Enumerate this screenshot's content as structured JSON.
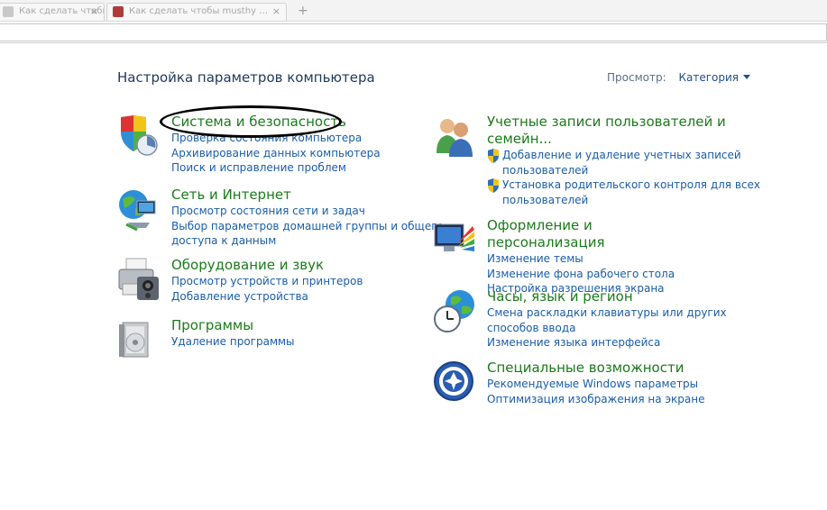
{
  "browser": {
    "tabs": [
      {
        "label": "Как сделать чтобы при вк…"
      },
      {
        "label": "Как сделать чтобы musthy …"
      }
    ],
    "new_tab_symbol": "+",
    "close_symbol": "×"
  },
  "header": {
    "title": "Настройка параметров компьютера",
    "view_label": "Просмотр:",
    "view_value": "Категория"
  },
  "left_column": [
    {
      "icon": "shield-security-icon",
      "title": "Система и безопасность",
      "links": [
        "Проверка состояния компьютера",
        "Архивирование данных компьютера",
        "Поиск и исправление проблем"
      ]
    },
    {
      "icon": "network-globe-icon",
      "title": "Сеть и Интернет",
      "links": [
        "Просмотр состояния сети и задач",
        "Выбор параметров домашней группы и общего",
        "доступа к данным"
      ]
    },
    {
      "icon": "printer-hardware-icon",
      "title": "Оборудование и звук",
      "links": [
        "Просмотр устройств и принтеров",
        "Добавление устройства"
      ]
    },
    {
      "icon": "programs-box-icon",
      "title": "Программы",
      "links": [
        "Удаление программы"
      ]
    }
  ],
  "right_column": [
    {
      "icon": "users-icon",
      "title_line1": "Учетные записи пользователей и",
      "title_line2": "семейн...",
      "shield_links": [
        {
          "line1": "Добавление и удаление учетных записей",
          "line2": "пользователей"
        },
        {
          "line1": "Установка родительского контроля для всех",
          "line2": "пользователей"
        }
      ]
    },
    {
      "icon": "appearance-monitor-icon",
      "title": "Оформление и персонализация",
      "links": [
        "Изменение темы",
        "Изменение фона рабочего стола",
        "Настройка разрешения экрана"
      ]
    },
    {
      "icon": "clock-globe-icon",
      "title": "Часы, язык и регион",
      "links": [
        "Смена раскладки клавиатуры или других",
        "способов ввода",
        "Изменение языка интерфейса"
      ]
    },
    {
      "icon": "ease-of-access-icon",
      "title": "Специальные возможности",
      "links": [
        "Рекомендуемые Windows параметры",
        "Оптимизация изображения на экране"
      ]
    }
  ]
}
